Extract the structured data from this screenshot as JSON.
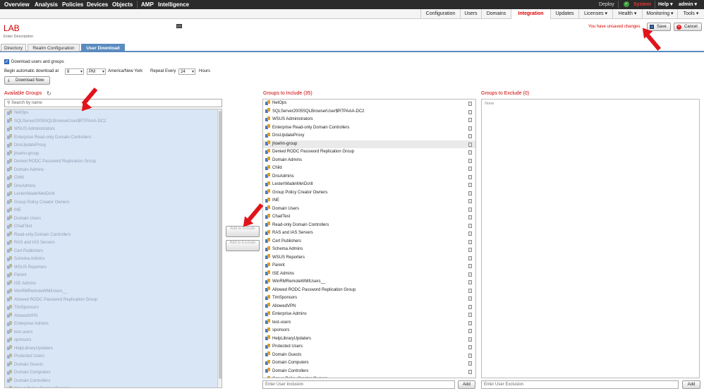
{
  "top_nav": {
    "items": [
      "Overview",
      "Analysis",
      "Policies",
      "Devices",
      "Objects",
      "AMP",
      "Intelligence"
    ],
    "right": {
      "deploy": "Deploy",
      "system": "System",
      "help": "Help ▾",
      "admin": "admin ▾"
    }
  },
  "sub_nav": [
    "Configuration",
    "Users",
    "Domains",
    "Integration",
    "Updates",
    "Licenses ▾",
    "Health ▾",
    "Monitoring ▾",
    "Tools ▾"
  ],
  "page": {
    "title": "LAB",
    "description": "Enter Description",
    "unsaved": "You have unsaved changes",
    "save": "Save",
    "cancel": "Cancel"
  },
  "tabs": [
    "Directory",
    "Realm Configuration",
    "User Download"
  ],
  "download": {
    "checkbox_label": "Download users and groups",
    "begin_label": "Begin automatic download at",
    "hour": "8",
    "ampm": "PM",
    "timezone": "America/New York",
    "repeat_label": "Repeat Every",
    "repeat_value": "24",
    "hours_label": "Hours",
    "download_now": "Download Now"
  },
  "available": {
    "title": "Available Groups",
    "search_placeholder": "Search by name",
    "items": [
      "NetOps",
      "SQLServer2005SQLBrowserUser$RTPAAA-DC2",
      "WSUS Administrators",
      "Enterprise Read-only Domain Controllers",
      "DnsUpdateProxy",
      "jhoehn-group",
      "Denied RODC Password Replication Group",
      "Domain Admins",
      "Child",
      "DnsAdmins",
      "Lester\\Made\\Me\\Do\\It",
      "Group Policy Creator Owners",
      "INE",
      "Domain Users",
      "ChadTest",
      "Read-only Domain Controllers",
      "RAS and IAS Servers",
      "Cert Publishers",
      "Schema Admins",
      "WSUS Reporters",
      "Parent",
      "ISE Admins",
      "WinRMRemoteWMIUsers__",
      "Allowed RODC Password Replication Group",
      "TimSponsors",
      "AllowedVPN",
      "Enterprise Admins",
      "test-users",
      "sponsors",
      "HelpLibraryUpdaters",
      "Protected Users",
      "Domain Guests",
      "Domain Computers",
      "Domain Controllers",
      "Group Policy Creator Owners"
    ]
  },
  "buttons": {
    "add_include": "Add to Include",
    "add_exclude": "Add to Exclude"
  },
  "include": {
    "title": "Groups to Include (35)",
    "items": [
      "NetOps",
      "SQLServer2005SQLBrowserUser$RTPAAA-DC2",
      "WSUS Administrators",
      "Enterprise Read-only Domain Controllers",
      "DnsUpdateProxy",
      "jhoehn-group",
      "Denied RODC Password Replication Group",
      "Domain Admins",
      "Child",
      "DnsAdmins",
      "Lester\\Made\\Me\\Do\\It",
      "Group Policy Creator Owners",
      "INE",
      "Domain Users",
      "ChadTest",
      "Read-only Domain Controllers",
      "RAS and IAS Servers",
      "Cert Publishers",
      "Schema Admins",
      "WSUS Reporters",
      "Parent",
      "ISE Admins",
      "WinRMRemoteWMIUsers__",
      "Allowed RODC Password Replication Group",
      "TimSponsors",
      "AllowedVPN",
      "Enterprise Admins",
      "test-users",
      "sponsors",
      "HelpLibraryUpdaters",
      "Protected Users",
      "Domain Guests",
      "Domain Computers",
      "Domain Controllers",
      "Group Policy Creator Owners"
    ],
    "input_placeholder": "Enter User Inclusion",
    "add": "Add"
  },
  "exclude": {
    "title": "Groups to Exclude (0)",
    "none": "None",
    "input_placeholder": "Enter User Exclusion",
    "add": "Add"
  }
}
